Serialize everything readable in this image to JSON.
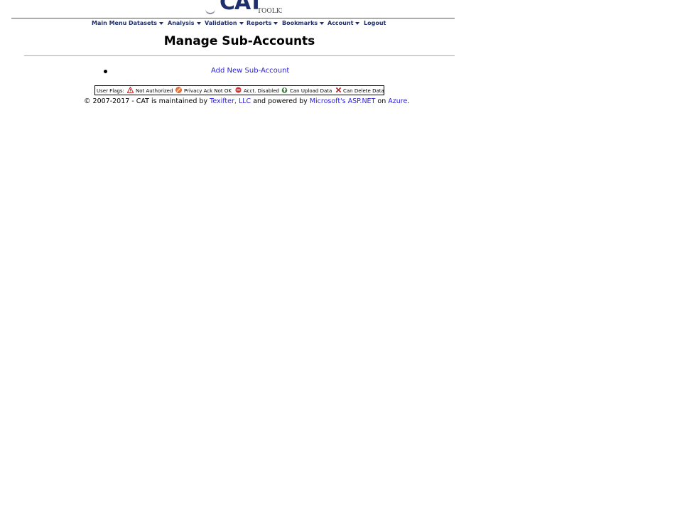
{
  "header": {
    "logo_text": "CAT",
    "logo_subtext": "TOOLKIT"
  },
  "nav": {
    "items": [
      {
        "label": "Main Menu",
        "has_dropdown": false
      },
      {
        "label": "Datasets",
        "has_dropdown": true
      },
      {
        "label": "Analysis",
        "has_dropdown": true
      },
      {
        "label": "Validation",
        "has_dropdown": true
      },
      {
        "label": "Reports",
        "has_dropdown": true
      },
      {
        "label": "Bookmarks",
        "has_dropdown": true
      },
      {
        "label": "Account",
        "has_dropdown": true
      },
      {
        "label": "Logout",
        "has_dropdown": false
      }
    ]
  },
  "main": {
    "title": "Manage Sub-Accounts",
    "add_link_label": "Add New Sub-Account"
  },
  "legend": {
    "label": "User Flags:",
    "items": [
      {
        "icon": "warning-triangle-icon",
        "label": "Not Authorized"
      },
      {
        "icon": "privacy-not-ok-icon",
        "label": "Privacy Ack Not OK"
      },
      {
        "icon": "no-entry-icon",
        "label": "Acct. Disabled"
      },
      {
        "icon": "upload-icon",
        "label": "Can Upload Data"
      },
      {
        "icon": "delete-x-icon",
        "label": "Can Delete Data"
      }
    ]
  },
  "footer": {
    "prefix": "© 2007-2017 - CAT is maintained by",
    "maintainer_link": "Texifter, LLC",
    "middle": "and powered by",
    "platform_link": "Microsoft's ASP.NET",
    "on_text": "on",
    "host_link": "Azure",
    "suffix": "."
  },
  "colors": {
    "nav_text": "#1f2f6e",
    "link": "#2a1fd8"
  }
}
